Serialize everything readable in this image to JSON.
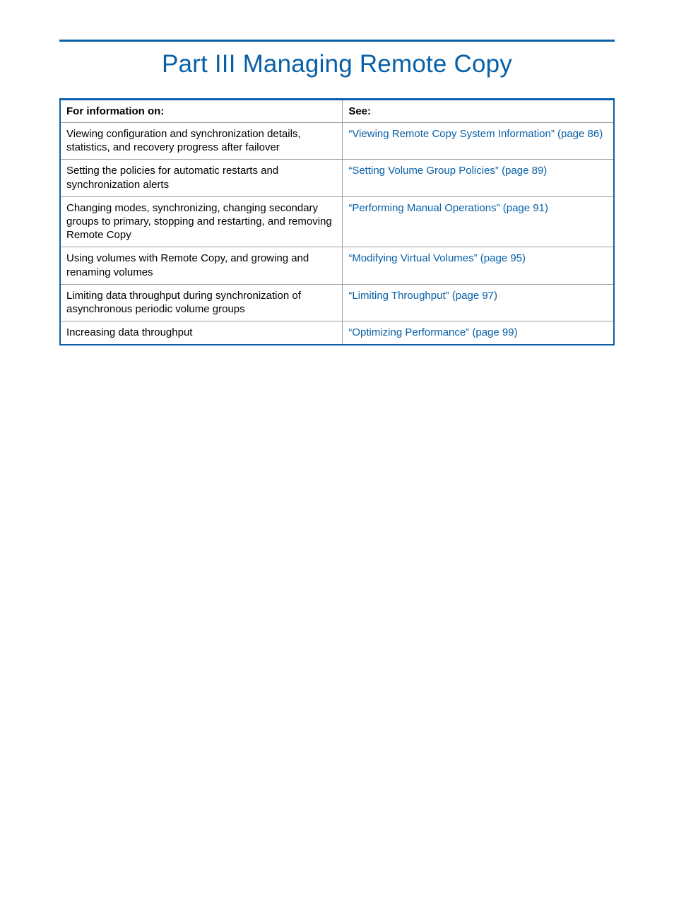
{
  "title": "Part III Managing Remote Copy",
  "table": {
    "headers": {
      "info": "For information on:",
      "see": "See:"
    },
    "rows": [
      {
        "info": "Viewing configuration and synchronization details, statistics, and recovery progress after failover",
        "see": "“Viewing Remote Copy System Information” (page 86)"
      },
      {
        "info": "Setting the policies for automatic restarts and synchronization alerts",
        "see": "“Setting Volume Group Policies” (page 89)"
      },
      {
        "info": "Changing modes, synchronizing, changing secondary groups to primary, stopping and restarting, and removing Remote Copy",
        "see": "“Performing Manual Operations” (page 91)"
      },
      {
        "info": "Using volumes with Remote Copy, and growing and renaming volumes",
        "see": "“Modifying Virtual Volumes” (page 95)"
      },
      {
        "info": "Limiting data throughput during synchronization of asynchronous periodic volume groups",
        "see": "“Limiting Throughput” (page 97)"
      },
      {
        "info": "Increasing data throughput",
        "see": "“Optimizing Performance” (page 99)"
      }
    ]
  }
}
